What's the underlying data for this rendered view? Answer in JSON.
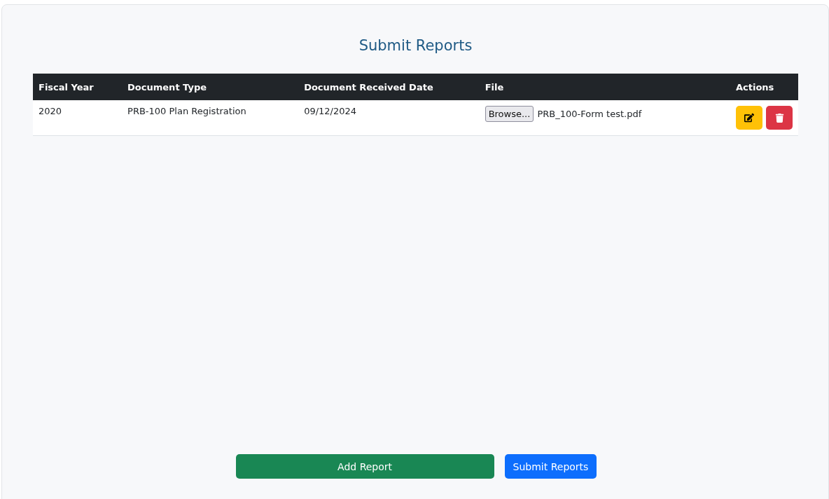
{
  "title": "Submit Reports",
  "table": {
    "columns": [
      "Fiscal Year",
      "Document Type",
      "Document Received Date",
      "File",
      "Actions"
    ],
    "rows": [
      {
        "fiscal_year": "2020",
        "document_type": "PRB-100 Plan Registration",
        "received_date": "09/12/2024",
        "file": {
          "button": "Browse...",
          "name": "PRB_100-Form test.pdf"
        },
        "actions": [
          {
            "kind": "edit"
          },
          {
            "kind": "delete"
          }
        ]
      }
    ]
  },
  "buttons": [
    {
      "kind": "add",
      "label": "Add Report"
    },
    {
      "kind": "submit",
      "label": "Submit Reports"
    }
  ]
}
